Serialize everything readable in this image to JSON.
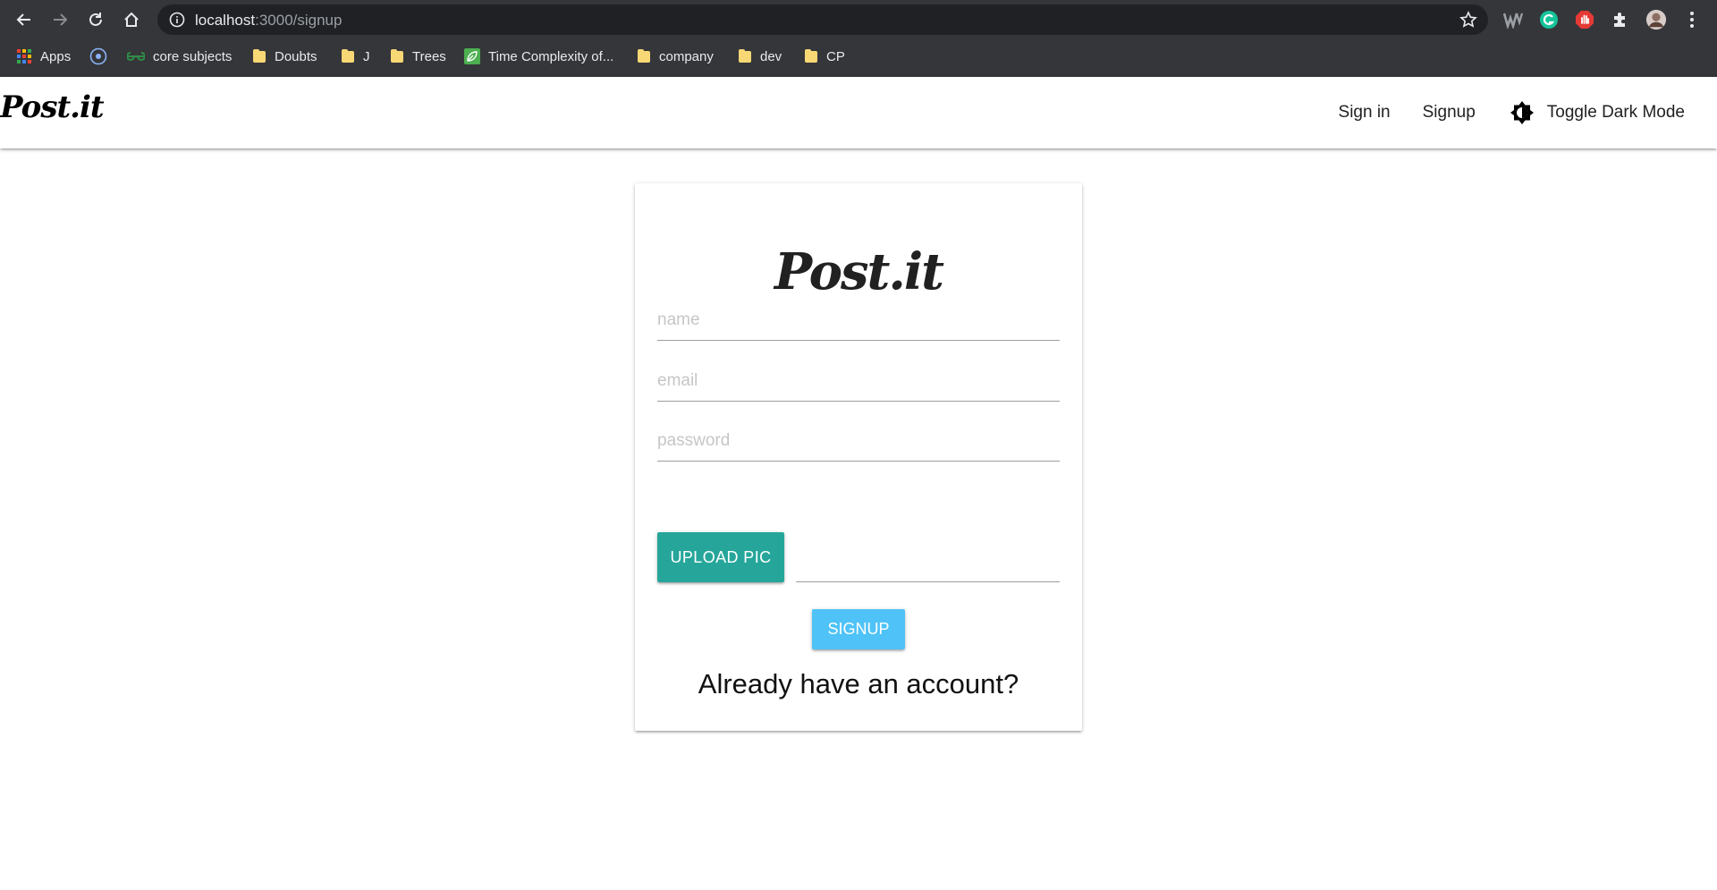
{
  "browser": {
    "url_host": "localhost",
    "url_path": ":3000/signup",
    "bookmarks": [
      {
        "label": "Apps",
        "icon": "apps-grid-icon"
      },
      {
        "label": "",
        "icon": "circle-target-icon"
      },
      {
        "label": "core subjects",
        "icon": "geeksforgeeks-icon"
      },
      {
        "label": "Doubts",
        "icon": "folder-icon"
      },
      {
        "label": "J",
        "icon": "folder-icon"
      },
      {
        "label": "Trees",
        "icon": "folder-icon"
      },
      {
        "label": "Time Complexity of...",
        "icon": "leaf-icon"
      },
      {
        "label": "company",
        "icon": "folder-icon"
      },
      {
        "label": "dev",
        "icon": "folder-icon"
      },
      {
        "label": "CP",
        "icon": "folder-icon"
      }
    ]
  },
  "navbar": {
    "brand": "Post.it",
    "signin_label": "Sign in",
    "signup_label": "Signup",
    "toggle_label": "Toggle Dark Mode"
  },
  "form": {
    "title": "Post.it",
    "name_placeholder": "name",
    "email_placeholder": "email",
    "password_placeholder": "password",
    "upload_label": "UPLOAD PIC",
    "submit_label": "SIGNUP",
    "signin_prompt": "Already have an account?"
  },
  "colors": {
    "upload_button": "#26a69a",
    "signup_button": "#4fc3f7",
    "chrome_bg": "#35363a"
  }
}
